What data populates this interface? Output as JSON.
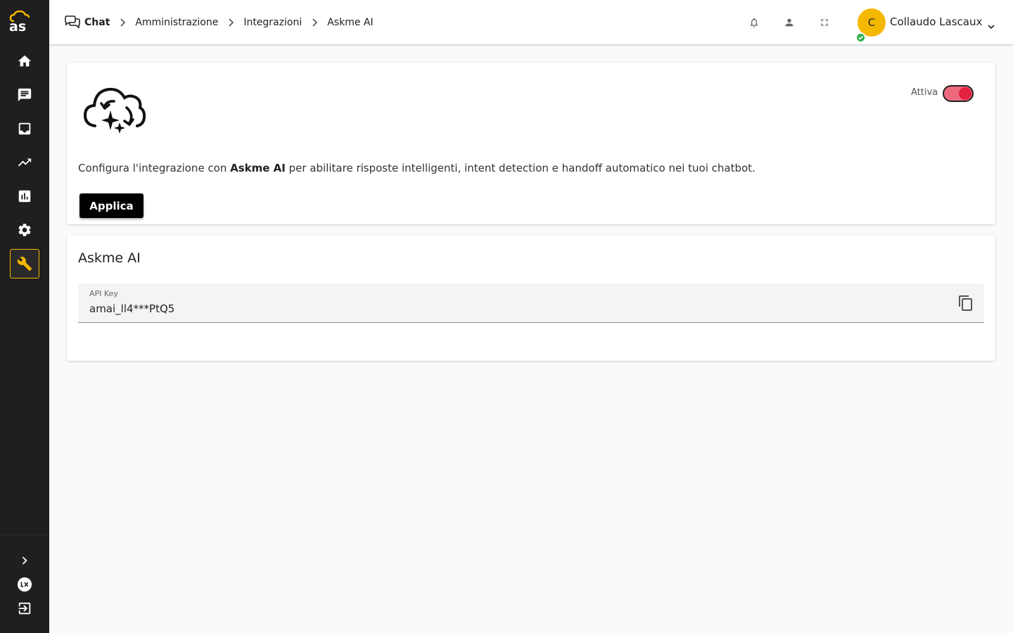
{
  "sidebar": {
    "logo_text": "as",
    "items": [
      {
        "name": "home",
        "icon": "home-icon"
      },
      {
        "name": "chat",
        "icon": "chat-icon"
      },
      {
        "name": "inbox",
        "icon": "inbox-icon"
      },
      {
        "name": "trends",
        "icon": "trending-up-icon"
      },
      {
        "name": "reports",
        "icon": "bar-chart-icon"
      },
      {
        "name": "settings",
        "icon": "gear-icon"
      },
      {
        "name": "integrations",
        "icon": "wrench-icon",
        "active": true
      }
    ],
    "bottom": [
      {
        "name": "expand",
        "icon": "chevron-right-icon"
      },
      {
        "name": "lx",
        "icon": "lx-logo-icon"
      },
      {
        "name": "logout",
        "icon": "logout-icon"
      }
    ]
  },
  "breadcrumb": {
    "items": [
      "Chat",
      "Amministrazione",
      "Integrazioni",
      "Askme AI"
    ]
  },
  "header": {
    "avatar_initial": "C",
    "user_name": "Collaudo Lascaux",
    "status": "online"
  },
  "integration": {
    "toggle_label": "Attiva",
    "toggle_on": true,
    "desc_prefix": "Configura l'integrazione con ",
    "desc_name": "Askme AI",
    "desc_suffix": " per abilitare risposte intelligenti, intent detection e handoff automatico nei tuoi chatbot.",
    "apply_label": "Applica"
  },
  "settings": {
    "title": "Askme AI",
    "api_key_label": "API Key",
    "api_key_value": "amai_ll4***PtQ5"
  },
  "colors": {
    "accent": "#f5b800",
    "toggle": "#e3223f",
    "online": "#2fb24c"
  }
}
